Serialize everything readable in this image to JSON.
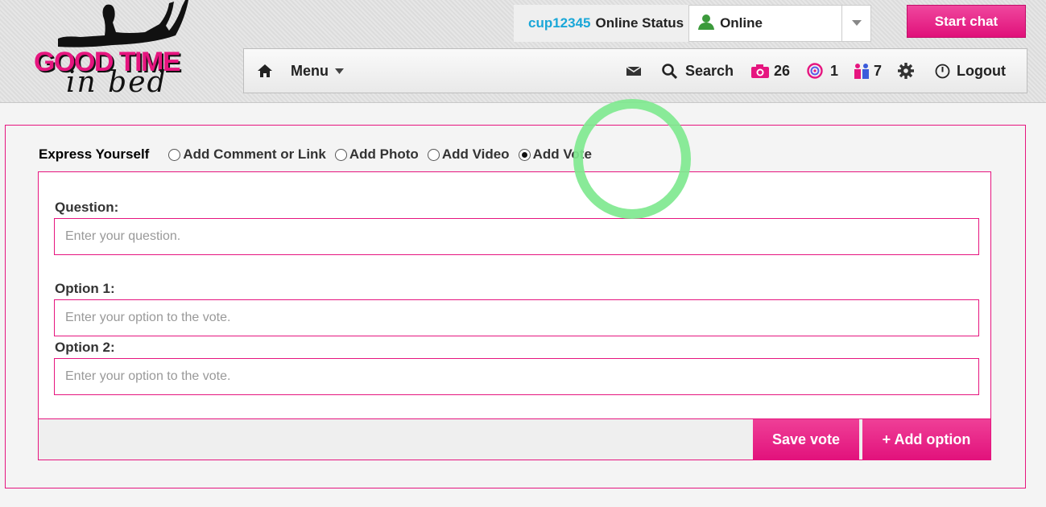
{
  "logo": {
    "title": "GOOD TIME",
    "subtitle": "in bed"
  },
  "header": {
    "username": "cup12345",
    "status_label": "Online Status",
    "status_value": "Online",
    "start_chat_label": "Start chat"
  },
  "nav": {
    "menu_label": "Menu",
    "search_label": "Search",
    "photos_count": "26",
    "visits_count": "1",
    "matches_count": "7",
    "logout_label": "Logout"
  },
  "express": {
    "label": "Express Yourself",
    "options": [
      {
        "label": "Add Comment or Link",
        "checked": false
      },
      {
        "label": "Add Photo",
        "checked": false
      },
      {
        "label": "Add Video",
        "checked": false
      },
      {
        "label": "Add Vote",
        "checked": true
      }
    ]
  },
  "form": {
    "question_label": "Question:",
    "question_placeholder": "Enter your question.",
    "option1_label": "Option 1:",
    "option1_placeholder": "Enter your option to the vote.",
    "option2_label": "Option 2:",
    "option2_placeholder": "Enter your option to the vote.",
    "save_label": "Save vote",
    "add_option_label": "+ Add option"
  },
  "colors": {
    "accent": "#e6157f",
    "username": "#1aa7d8",
    "online": "#3c9a3c",
    "highlight": "#7fe88f"
  }
}
